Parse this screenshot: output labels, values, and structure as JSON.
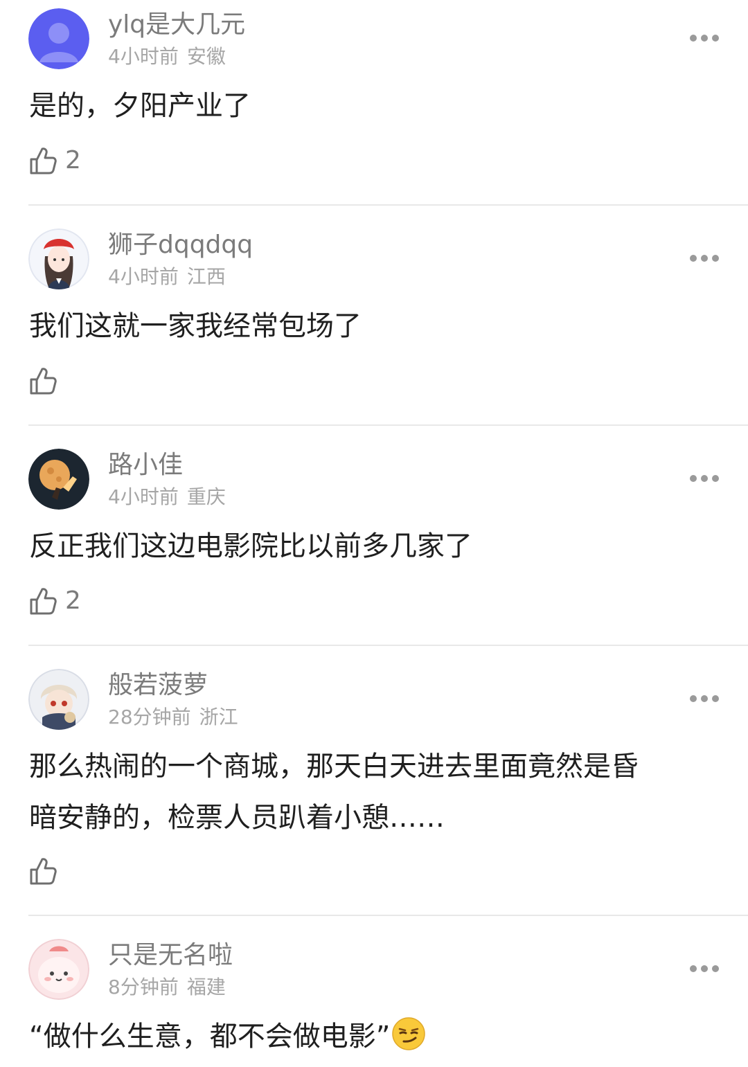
{
  "comments": [
    {
      "username": "ylq是大几元",
      "time": "4小时前",
      "location": "安徽",
      "text": "是的，夕阳产业了",
      "likes": "2",
      "avatar": "default-user-avatar"
    },
    {
      "username": "狮子dqqdqq",
      "time": "4小时前",
      "location": "江西",
      "text": "我们这就一家我经常包场了",
      "likes": "",
      "avatar": "girl-with-red-beret-avatar"
    },
    {
      "username": "路小佳",
      "time": "4小时前",
      "location": "重庆",
      "text": "反正我们这边电影院比以前多几家了",
      "likes": "2",
      "avatar": "full-moon-avatar"
    },
    {
      "username": "般若菠萝",
      "time": "28分钟前",
      "location": "浙江",
      "text_lines": [
        "那么热闹的一个商城，那天白天进去里面竟然是昏",
        "暗安静的，检票人员趴着小憩……"
      ],
      "likes": "",
      "avatar": "anime-character-avatar"
    },
    {
      "username": "只是无名啦",
      "time": "8分钟前",
      "location": "福建",
      "text": "“做什么生意，都不会做电影”",
      "emoji": "smirk-emoji",
      "likes": "",
      "avatar": "pink-blob-avatar"
    }
  ],
  "colors": {
    "username": "#7b7b7b",
    "meta": "#a6a6a6",
    "text": "#1f1f1f",
    "divider": "#e8e8e8",
    "default_avatar": "#5b5ef0"
  },
  "icons": {
    "more": "more-dots-icon",
    "like": "thumbs-up-icon"
  }
}
